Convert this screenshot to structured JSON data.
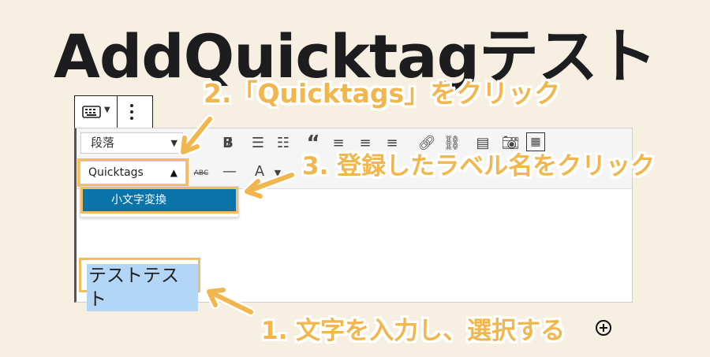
{
  "title": "AddQuicktagテスト",
  "editor": {
    "format_select": "段落",
    "quicktags_select": "Quicktags",
    "dropdown_item": "小文字変換",
    "selected_text": "テストテスト"
  },
  "annotations": {
    "step2": "2.「Quicktags」をクリック",
    "step3": "3. 登録したラベル名をクリック",
    "step1": "1. 文字を入力し、選択する"
  },
  "colors": {
    "annotation": "#f2b64e",
    "selection": "#0a73aa",
    "highlight": "#b4d6f6"
  }
}
